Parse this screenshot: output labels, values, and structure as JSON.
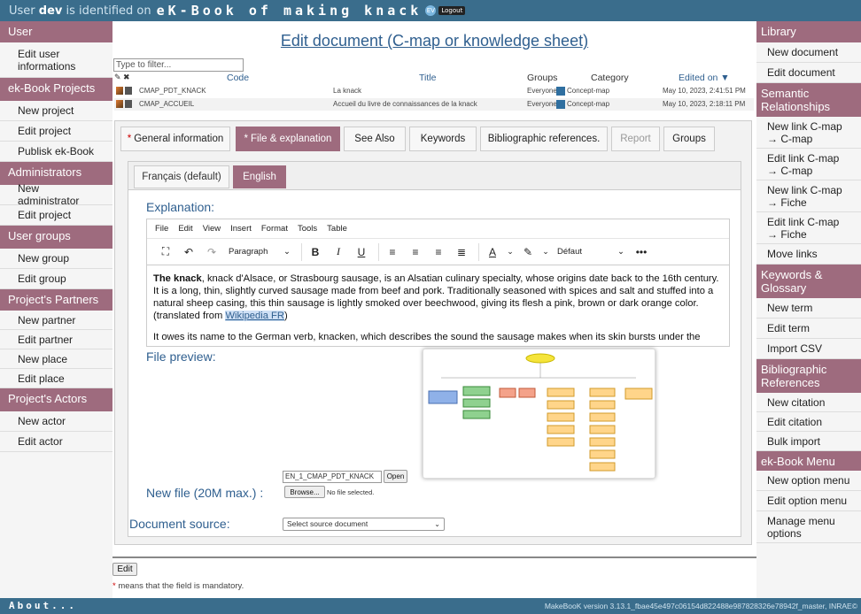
{
  "top": {
    "prefix": "User ",
    "user": "dev",
    "suffix": " is identified on ",
    "brand": "eK-Book of making knack",
    "lang_badge": "EV",
    "logout": "Logout"
  },
  "left": [
    {
      "head": "User",
      "items": [
        "Edit user informations"
      ]
    },
    {
      "head": "ek-Book Projects",
      "items": [
        "New project",
        "Edit project",
        "Publisk ek-Book"
      ]
    },
    {
      "head": "Administrators",
      "items": [
        "New administrator",
        "Edit project"
      ]
    },
    {
      "head": "User groups",
      "items": [
        "New group",
        "Edit group"
      ]
    },
    {
      "head": "Project's Partners",
      "items": [
        "New partner",
        "Edit partner",
        "New place",
        "Edit place"
      ]
    },
    {
      "head": "Project's Actors",
      "items": [
        "New actor",
        "Edit actor"
      ]
    }
  ],
  "right": [
    {
      "head": "Library",
      "items": [
        "New document",
        "Edit document"
      ]
    },
    {
      "head": "Semantic Relationships",
      "items": [
        "New link C-map → C-map",
        "Edit link C-map → C-map",
        "New link C-map → Fiche",
        "Edit link C-map → Fiche",
        "Move links"
      ]
    },
    {
      "head": "Keywords & Glossary",
      "items": [
        "New term",
        "Edit term",
        "Import CSV"
      ]
    },
    {
      "head": "Bibliographic References",
      "items": [
        "New citation",
        "Edit citation",
        "Bulk import"
      ]
    },
    {
      "head": "ek-Book Menu",
      "items": [
        "New option menu",
        "Edit option menu",
        "Manage menu options"
      ]
    }
  ],
  "main": {
    "title": "Edit document (C-map or knowledge sheet)",
    "filter_placeholder": "Type to filter...",
    "columns": {
      "code": "Code",
      "title": "Title",
      "groups": "Groups",
      "category": "Category",
      "edited": "Edited on ▼"
    },
    "rows": [
      {
        "code": "CMAP_PDT_KNACK",
        "title": "La knack",
        "groups": "Everyone",
        "category": "Concept-map",
        "edited": "May 10, 2023, 2:41:51 PM"
      },
      {
        "code": "CMAP_ACCUEIL",
        "title": "Accueil du livre de connaissances de la knack",
        "groups": "Everyone",
        "category": "Concept-map",
        "edited": "May 10, 2023, 2:18:11 PM"
      }
    ],
    "tabs": [
      {
        "label": "General information",
        "req": "*"
      },
      {
        "label": "File & explanation",
        "req": "*"
      },
      {
        "label": "See Also",
        "req": ""
      },
      {
        "label": "Keywords",
        "req": ""
      },
      {
        "label": "Bibliographic references.",
        "req": ""
      },
      {
        "label": "Report",
        "req": ""
      },
      {
        "label": "Groups",
        "req": ""
      }
    ],
    "lang_tabs": [
      "Français (default)",
      "English"
    ],
    "explanation_label": "Explanation:",
    "editor_menu": [
      "File",
      "Edit",
      "View",
      "Insert",
      "Format",
      "Tools",
      "Table"
    ],
    "editor_paragraph": "Paragraph",
    "editor_font": "Défaut",
    "text_bold": "The knack",
    "text_p1": ", knack d'Alsace, or Strasbourg sausage, is an Alsatian culinary specialty, whose origins date back to the 16th century. It is a long, thin, slightly curved sausage made from beef and pork. Traditionally seasoned with spices and salt and stuffed into a natural sheep casing, this thin sausage is lightly smoked over beechwood, giving its flesh a pink, brown or dark orange color. (translated from ",
    "text_link": "Wikipedia FR",
    "text_p1_end": ")",
    "text_p2": "It owes its name to the German verb, knacken, which describes the sound the sausage makes when its skin bursts under the",
    "file_preview_label": "File preview:",
    "file_name": "EN_1_CMAP_PDT_KNACK",
    "open_btn": "Open",
    "new_file_label": "New file (20M max.) :",
    "browse_btn": "Browse...",
    "no_file": "No file selected.",
    "doc_source_label": "Document source:",
    "doc_source_placeholder": "Select source document",
    "edit_btn": "Edit",
    "mandatory_star": "*",
    "mandatory_text": " means that the field is mandatory."
  },
  "footer": {
    "about": "About...",
    "version": "MakeBooK version 3.13.1_fbae45e497c06154d822488e987828326e78942f_master, INRAE©"
  }
}
